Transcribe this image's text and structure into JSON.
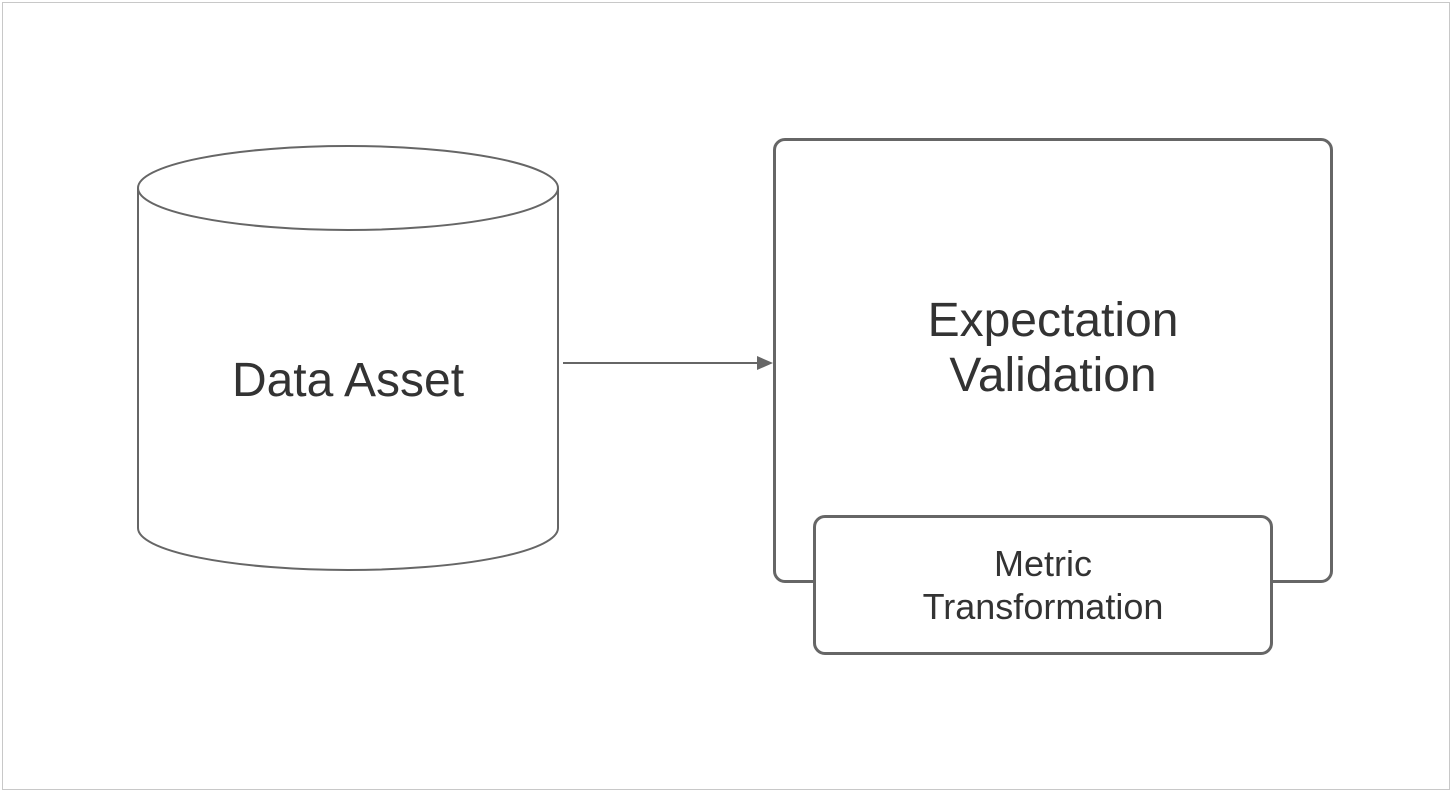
{
  "diagram": {
    "nodes": {
      "data_asset": {
        "type": "cylinder",
        "label": "Data Asset"
      },
      "expectation_validation": {
        "type": "rounded-rect",
        "label_line1": "Expectation",
        "label_line2": "Validation"
      },
      "metric_transformation": {
        "type": "rounded-rect",
        "label_line1": "Metric",
        "label_line2": "Transformation"
      }
    },
    "edges": [
      {
        "from": "data_asset",
        "to": "expectation_validation",
        "style": "arrow"
      }
    ]
  }
}
